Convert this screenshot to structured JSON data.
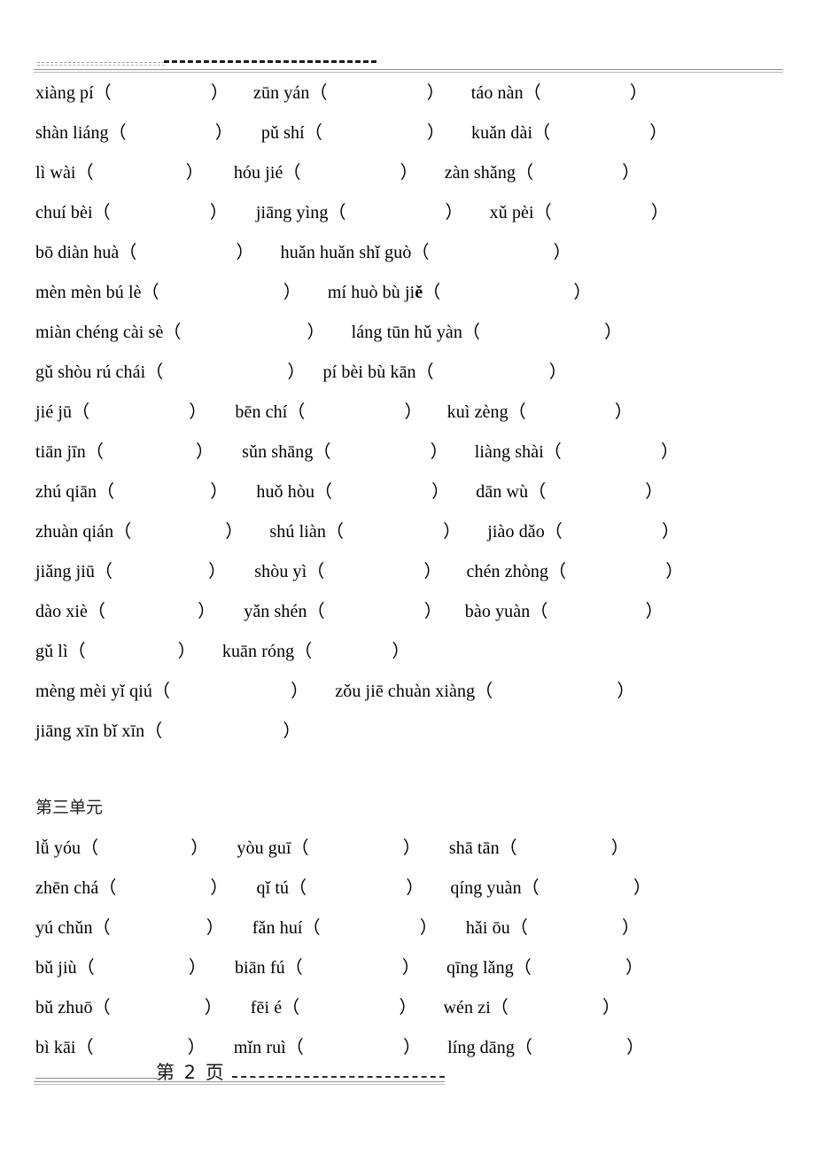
{
  "document": {
    "page_footer_label": "第 2 页",
    "unit_heading": "第三单元"
  },
  "rows": [
    {
      "id": "r1",
      "indent": 0,
      "items": [
        {
          "term": "xiàng pí",
          "gap": 112,
          "pre": 0
        },
        {
          "term": "zūn yán",
          "gap": 112,
          "pre": 28
        },
        {
          "term": "táo nàn",
          "gap": 100,
          "pre": 30
        }
      ]
    },
    {
      "id": "r2",
      "indent": 0,
      "items": [
        {
          "term": "shàn liáng",
          "gap": 100,
          "pre": 0
        },
        {
          "term": "pǔ shí",
          "gap": 118,
          "pre": 32
        },
        {
          "term": "kuǎn dài",
          "gap": 112,
          "pre": 30
        }
      ]
    },
    {
      "id": "r3",
      "indent": 0,
      "items": [
        {
          "term": "lì wài",
          "gap": 104,
          "pre": 0
        },
        {
          "term": "hóu jié",
          "gap": 112,
          "pre": 34
        },
        {
          "term": "zàn shǎng",
          "gap": 100,
          "pre": 30
        }
      ]
    },
    {
      "id": "r4",
      "indent": 0,
      "items": [
        {
          "term": "chuí bèi",
          "gap": 112,
          "pre": 0
        },
        {
          "term": "jiāng yìng",
          "gap": 112,
          "pre": 32
        },
        {
          "term": "xǔ pèi",
          "gap": 112,
          "pre": 30
        }
      ]
    },
    {
      "id": "r5",
      "indent": 0,
      "items": [
        {
          "term": "bō diàn huà",
          "gap": 112,
          "pre": 0
        },
        {
          "term": "huǎn huǎn shǐ guò",
          "gap": 140,
          "pre": 30
        }
      ]
    },
    {
      "id": "r6",
      "indent": 0,
      "items": [
        {
          "term": "mèn mèn bú lè",
          "gap": 140,
          "pre": 0
        },
        {
          "term": "mí huò bù jiě",
          "bold_tail": "ě",
          "gap": 150,
          "pre": 30
        }
      ]
    },
    {
      "id": "r7",
      "indent": 0,
      "items": [
        {
          "term": "miàn chéng cài sè",
          "gap": 142,
          "pre": 0
        },
        {
          "term": "láng tūn hǔ yàn",
          "gap": 140,
          "pre": 30
        }
      ]
    },
    {
      "id": "r8",
      "indent": 0,
      "items": [
        {
          "term": "gǔ shòu rú chái",
          "gap": 140,
          "pre": 0
        },
        {
          "term": "pí bèi bù kān",
          "gap": 130,
          "pre": 20
        }
      ]
    },
    {
      "id": "r9",
      "indent": 0,
      "items": [
        {
          "term": "jié jū",
          "gap": 112,
          "pre": 0
        },
        {
          "term": "bēn chí",
          "gap": 112,
          "pre": 32
        },
        {
          "term": "kuì zèng",
          "gap": 100,
          "pre": 28
        }
      ]
    },
    {
      "id": "r10",
      "indent": 0,
      "items": [
        {
          "term": "tiān jīn",
          "gap": 104,
          "pre": 0
        },
        {
          "term": "sǔn shāng",
          "gap": 112,
          "pre": 32
        },
        {
          "term": "liàng shài",
          "gap": 112,
          "pre": 30
        }
      ]
    },
    {
      "id": "r11",
      "indent": 0,
      "items": [
        {
          "term": "zhú qiān",
          "gap": 108,
          "pre": 0
        },
        {
          "term": "huǒ hòu",
          "gap": 112,
          "pre": 32
        },
        {
          "term": "dān wù",
          "gap": 112,
          "pre": 30
        }
      ]
    },
    {
      "id": "r12",
      "indent": 0,
      "items": [
        {
          "term": "zhuàn qián",
          "gap": 106,
          "pre": 0
        },
        {
          "term": "shú liàn",
          "gap": 112,
          "pre": 30
        },
        {
          "term": "jiào dǎo",
          "gap": 112,
          "pre": 30
        }
      ]
    },
    {
      "id": "r13",
      "indent": 0,
      "items": [
        {
          "term": "jiǎng jiū",
          "gap": 108,
          "pre": 0
        },
        {
          "term": "shòu yì",
          "gap": 112,
          "pre": 32
        },
        {
          "term": "chén zhòng",
          "gap": 112,
          "pre": 28
        }
      ]
    },
    {
      "id": "r14",
      "indent": 0,
      "items": [
        {
          "term": "dào xiè",
          "gap": 104,
          "pre": 0
        },
        {
          "term": "yǎn shén",
          "gap": 112,
          "pre": 32
        },
        {
          "term": "bào yuàn",
          "gap": 110,
          "pre": 26
        }
      ]
    },
    {
      "id": "r15",
      "indent": 0,
      "items": [
        {
          "term": "gǔ lì",
          "gap": 104,
          "pre": 0
        },
        {
          "term": "kuān róng",
          "gap": 90,
          "pre": 30
        }
      ]
    },
    {
      "id": "r16",
      "indent": 0,
      "items": [
        {
          "term": "mèng mèi yǐ qiú",
          "gap": 136,
          "pre": 0
        },
        {
          "term": "zǒu jiē chuàn xiàng",
          "gap": 140,
          "pre": 30
        }
      ]
    },
    {
      "id": "r17",
      "indent": 0,
      "items": [
        {
          "term": "jiāng xīn bǐ xīn",
          "gap": 136,
          "pre": 0
        }
      ]
    }
  ],
  "unit3_rows": [
    {
      "id": "u1",
      "indent": 0,
      "items": [
        {
          "term": "lǚ yóu",
          "gap": 104,
          "pre": 0
        },
        {
          "term": "yòu guī",
          "gap": 106,
          "pre": 32
        },
        {
          "term": "shā tān",
          "gap": 106,
          "pre": 32
        }
      ]
    },
    {
      "id": "u2",
      "indent": 0,
      "items": [
        {
          "term": "zhēn chá",
          "gap": 106,
          "pre": 0
        },
        {
          "term": "qǐ tú",
          "gap": 112,
          "pre": 32
        },
        {
          "term": "qíng yuàn",
          "gap": 106,
          "pre": 30
        }
      ]
    },
    {
      "id": "u3",
      "indent": 0,
      "items": [
        {
          "term": "yú chǔn",
          "gap": 108,
          "pre": 0
        },
        {
          "term": "fǎn huí",
          "gap": 112,
          "pre": 32
        },
        {
          "term": "hǎi ōu",
          "gap": 106,
          "pre": 32
        }
      ]
    },
    {
      "id": "u4",
      "indent": 0,
      "items": [
        {
          "term": "bǔ jiù",
          "gap": 106,
          "pre": 0
        },
        {
          "term": "biān fú",
          "gap": 112,
          "pre": 32
        },
        {
          "term": "qīng lǎng",
          "gap": 106,
          "pre": 30
        }
      ]
    },
    {
      "id": "u5",
      "indent": 0,
      "items": [
        {
          "term": "bǔ zhuō",
          "gap": 106,
          "pre": 0
        },
        {
          "term": "fēi é",
          "gap": 112,
          "pre": 32
        },
        {
          "term": "wén zi",
          "gap": 106,
          "pre": 30
        }
      ]
    },
    {
      "id": "u6",
      "indent": 0,
      "items": [
        {
          "term": "bì kāi",
          "gap": 106,
          "pre": 0
        },
        {
          "term": "mǐn ruì",
          "gap": 112,
          "pre": 32
        },
        {
          "term": "líng dāng",
          "gap": 106,
          "pre": 30
        }
      ]
    }
  ]
}
